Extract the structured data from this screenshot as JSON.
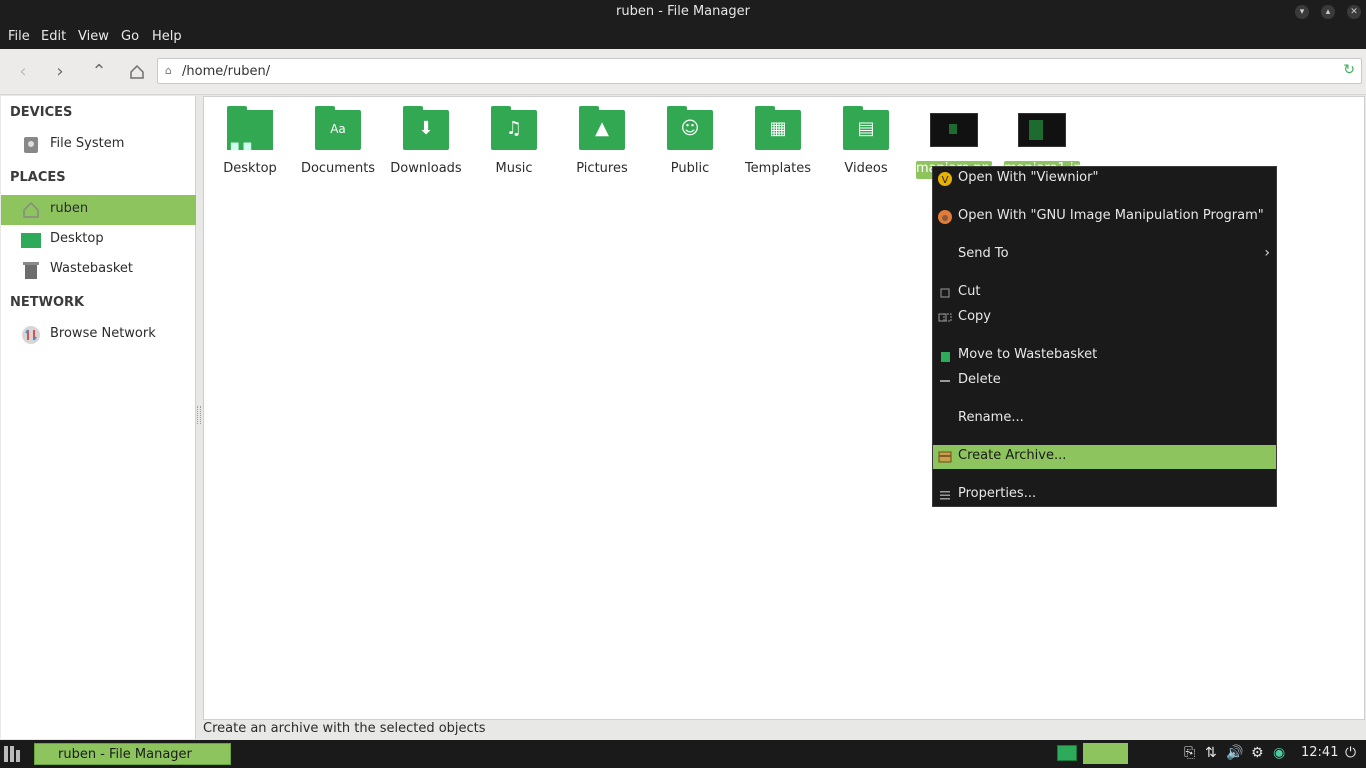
{
  "window": {
    "title": "ruben - File Manager",
    "controls": [
      "minimize",
      "maximize",
      "close"
    ]
  },
  "menubar": [
    "File",
    "Edit",
    "View",
    "Go",
    "Help"
  ],
  "toolbar": {
    "path": "/home/ruben/"
  },
  "sidebar": {
    "devices_heading": "DEVICES",
    "places_heading": "PLACES",
    "network_heading": "NETWORK",
    "file_system": "File System",
    "ruben": "ruben",
    "desktop": "Desktop",
    "wastebasket": "Wastebasket",
    "browse_network": "Browse Network"
  },
  "files": {
    "desktop": "Desktop",
    "documents": "Documents",
    "downloads": "Downloads",
    "music": "Music",
    "pictures": "Pictures",
    "public": "Public",
    "templates": "Templates",
    "videos": "Videos",
    "image1": "manjaro.png",
    "image2": "manjaro1.jpg"
  },
  "context_menu": {
    "open_viewnior": "Open With \"Viewnior\"",
    "open_gimp": "Open With \"GNU Image Manipulation Program\"",
    "send_to": "Send To",
    "cut": "Cut",
    "copy": "Copy",
    "move_to_wastebasket": "Move to Wastebasket",
    "delete": "Delete",
    "rename": "Rename...",
    "create_archive": "Create Archive...",
    "properties": "Properties..."
  },
  "statusbar": "Create an archive with the selected objects",
  "taskbar": {
    "task": "ruben - File Manager",
    "clock": "12:41"
  },
  "colors": {
    "accent": "#8dc45e",
    "folder": "#32a852",
    "dark": "#1d1d1d"
  }
}
